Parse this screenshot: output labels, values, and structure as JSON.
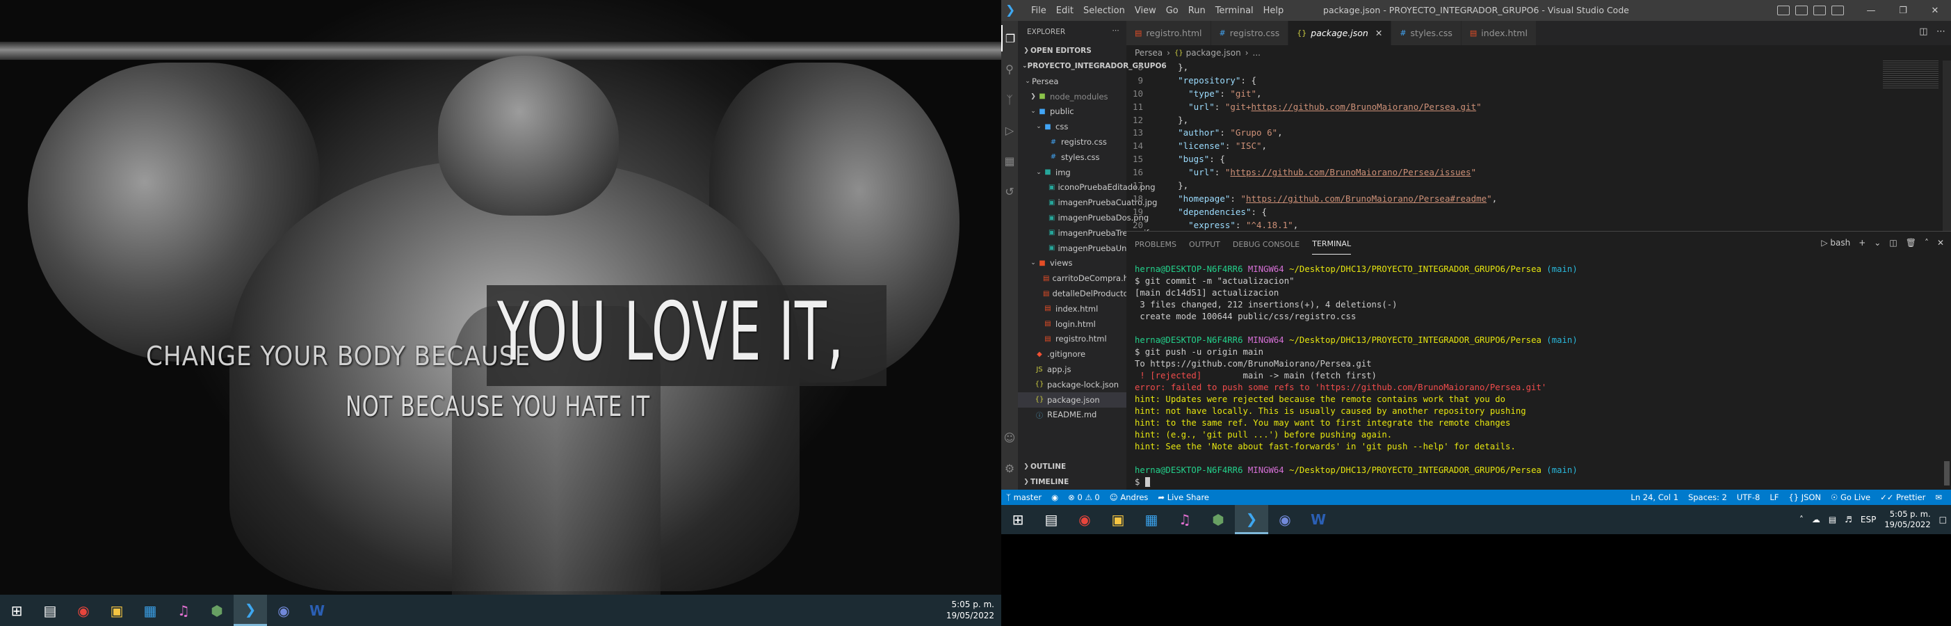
{
  "wallpaper": {
    "line1": "CHANGE YOUR BODY BECAUSE",
    "line2": "YOU LOVE IT,",
    "line3": "NOT BECAUSE YOU HATE IT"
  },
  "left_taskbar": {
    "time": "5:05 p. m.",
    "date": "19/05/2022",
    "icons": [
      "windows-start-icon",
      "task-view-icon",
      "chrome-icon",
      "file-explorer-icon",
      "store-icon",
      "itunes-icon",
      "node-icon",
      "vscode-icon",
      "discord-icon",
      "word-icon"
    ]
  },
  "vscode": {
    "menu": [
      "File",
      "Edit",
      "Selection",
      "View",
      "Go",
      "Run",
      "Terminal",
      "Help"
    ],
    "title": "package.json - PROYECTO_INTEGRADOR_GRUPO6 - Visual Studio Code",
    "explorer_label": "EXPLORER",
    "open_editors": "OPEN EDITORS",
    "project": "PROYECTO_INTEGRADOR_GRUPO6",
    "tree": {
      "persea": "Persea",
      "node_modules": "node_modules",
      "public": "public",
      "css": "css",
      "registro_css": "registro.css",
      "styles_css": "styles.css",
      "img": "img",
      "img1": "iconoPruebaEditado.png",
      "img2": "imagenPruebaCuatro.jpg",
      "img3": "imagenPruebaDos.png",
      "img4": "imagenPruebaTres.avif",
      "img5": "imagenPruebaUno.gif",
      "views": "views",
      "v1": "carritoDeCompra.html",
      "v2": "detalleDelProducto.html",
      "v3": "index.html",
      "v4": "login.html",
      "v5": "registro.html",
      "gitignore": ".gitignore",
      "app": "app.js",
      "pkglock": "package-lock.json",
      "pkg": "package.json",
      "readme": "README.md"
    },
    "outline": "OUTLINE",
    "timeline": "TIMELINE",
    "tabs": [
      "registro.html",
      "registro.css",
      "package.json",
      "styles.css",
      "index.html"
    ],
    "breadcrumb": [
      "Persea",
      "package.json",
      "..."
    ],
    "code_lines": {
      "l8": "8",
      "l9": "9",
      "l10": "10",
      "l11": "11",
      "l12": "12",
      "l13": "13",
      "l14": "14",
      "l15": "15",
      "l16": "16",
      "l17": "17",
      "l18": "18",
      "l19": "19",
      "l20": "20"
    },
    "code": {
      "c8": "},",
      "c9k": "\"repository\"",
      "c9p": ": {",
      "c10k": "\"type\"",
      "c10s": "\"git\"",
      "c11k": "\"url\"",
      "c11s1": "\"git+",
      "c11u": "https://github.com/BrunoMaiorano/Persea.git",
      "c11s2": "\"",
      "c12": "},",
      "c13k": "\"author\"",
      "c13s": "\"Grupo 6\"",
      "c14k": "\"license\"",
      "c14s": "\"ISC\"",
      "c15k": "\"bugs\"",
      "c15p": ": {",
      "c16k": "\"url\"",
      "c16s1": "\"",
      "c16u": "https://github.com/BrunoMaiorano/Persea/issues",
      "c16s2": "\"",
      "c17": "},",
      "c18k": "\"homepage\"",
      "c18s1": "\"",
      "c18u": "https://github.com/BrunoMaiorano/Persea#readme",
      "c18s2": "\"",
      "c19k": "\"dependencies\"",
      "c19p": ": {",
      "c20k": "\"express\"",
      "c20s": "\"^4.18.1\""
    },
    "panel_tabs": [
      "PROBLEMS",
      "OUTPUT",
      "DEBUG CONSOLE",
      "TERMINAL"
    ],
    "terminal_shell": "bash",
    "terminal": {
      "user": "herna@DESKTOP-N6F4RR6",
      "env": "MINGW64",
      "path": "~/Desktop/DHC13/PROYECTO_INTEGRADOR_GRUPO6/Persea",
      "branch": "(main)",
      "cmd1": "$ git commit -m \"actualizacion\"",
      "o1": "[main dc14d51] actualizacion",
      "o2": " 3 files changed, 212 insertions(+), 4 deletions(-)",
      "o3": " create mode 100644 public/css/registro.css",
      "cmd2": "$ git push -u origin main",
      "o4": "To https://github.com/BrunoMaiorano/Persea.git",
      "o5a": " ! [rejected]",
      "o5b": "        main -> main (fetch first)",
      "e1": "error: failed to push some refs to 'https://github.com/BrunoMaiorano/Persea.git'",
      "h1": "hint: Updates were rejected because the remote contains work that you do",
      "h2": "hint: not have locally. This is usually caused by another repository pushing",
      "h3": "hint: to the same ref. You may want to first integrate the remote changes",
      "h4": "hint: (e.g., 'git pull ...') before pushing again.",
      "h5": "hint: See the 'Note about fast-forwards' in 'git push --help' for details.",
      "prompt": "$ "
    },
    "status": {
      "branch": "master",
      "problems": "0 ⚠ 0",
      "user": "Andres",
      "liveshare": "Live Share",
      "position": "Ln 24, Col 1",
      "spaces": "Spaces: 2",
      "encoding": "UTF-8",
      "eol": "LF",
      "language": "JSON",
      "golive": "Go Live",
      "prettier": "Prettier"
    }
  },
  "right_taskbar": {
    "lang": "ESP",
    "time": "5:05 p. m.",
    "date": "19/05/2022"
  }
}
